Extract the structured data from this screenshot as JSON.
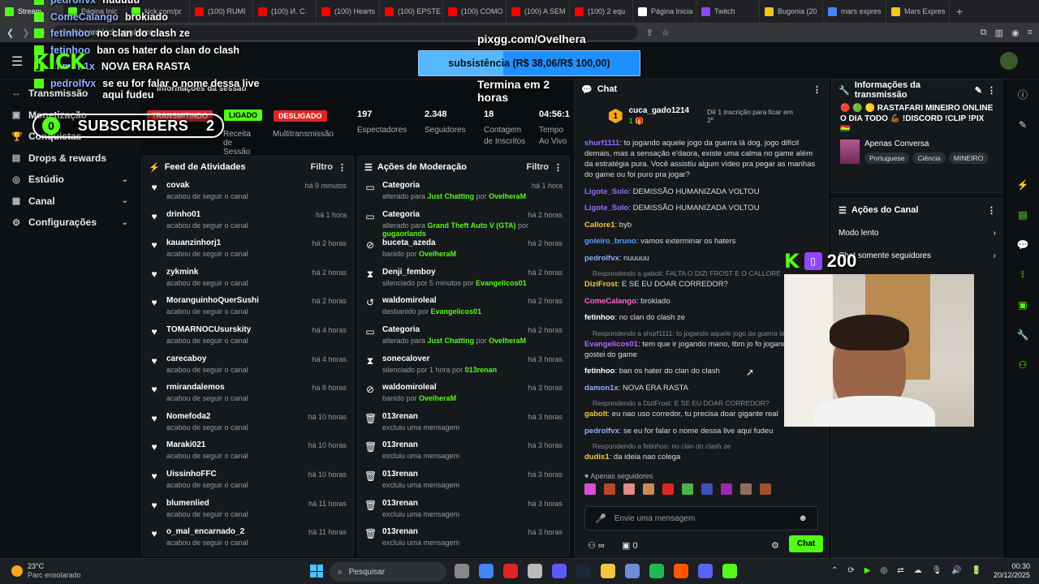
{
  "browser": {
    "tabs": [
      {
        "label": "Stream",
        "color": "#53fc18"
      },
      {
        "label": "Página Inic",
        "color": "#53fc18"
      },
      {
        "label": "kick.com/pr",
        "color": "#53fc18"
      },
      {
        "label": "(100) RUMI",
        "color": "#ff0000"
      },
      {
        "label": "(100) И. С.",
        "color": "#ff0000"
      },
      {
        "label": "(100) Hearts",
        "color": "#ff0000"
      },
      {
        "label": "(100) EPSTE",
        "color": "#ff0000"
      },
      {
        "label": "(100) COMO",
        "color": "#ff0000"
      },
      {
        "label": "(100) A SEM",
        "color": "#ff0000"
      },
      {
        "label": "(100) 2 equ",
        "color": "#ff0000"
      },
      {
        "label": "Página Inicia",
        "color": "#ffffff"
      },
      {
        "label": "Twitch",
        "color": "#9146ff"
      },
      {
        "label": "Bugonia (20",
        "color": "#f5c518"
      },
      {
        "label": "mars expres",
        "color": "#4285f4"
      },
      {
        "label": "Mars Expres",
        "color": "#f5c518"
      }
    ],
    "url": "dashboard.kick.com/stream"
  },
  "overlay": {
    "top_lines": [
      {
        "name": "pedrolfvx",
        "text": "nuuuuu"
      },
      {
        "name": "ComeCalango",
        "text": "brokiado"
      },
      {
        "name": "fetinhoo",
        "text": "no clan do clash ze"
      },
      {
        "name": "fetinhoo",
        "text": "ban os hater do clan do clash"
      },
      {
        "name": "damon1x",
        "text": "NOVA ERA RASTA"
      },
      {
        "name": "pedrolfvx",
        "text": "se eu for falar o nome dessa live aqui fudeu"
      }
    ],
    "logo": "KICK",
    "pix_url": "pixgg.com/Ovelhera",
    "goal": "subsistência (R$ 38,06/R$ 100,00)",
    "goal_progress": 0.3806,
    "ends": "Termina em 2 horas",
    "subs_left": "0",
    "subs_label": "SUBSCRIBERS",
    "subs_right": "2",
    "viewers": "200"
  },
  "sidebar": {
    "items": [
      {
        "icon": "↔",
        "label": "Transmissão"
      },
      {
        "icon": "▣",
        "label": "Monetização"
      },
      {
        "icon": "🏆",
        "label": "Conquistas"
      },
      {
        "icon": "▤",
        "label": "Drops & rewards"
      },
      {
        "icon": "◎",
        "label": "Estúdio"
      },
      {
        "icon": "▦",
        "label": "Canal"
      },
      {
        "icon": "⚙",
        "label": "Configurações"
      }
    ]
  },
  "stats": {
    "session_title": "Informações da sessão",
    "transmitindo": "TRANSMITINDO",
    "ligado": "LIGADO",
    "desligado": "DESLIGADO",
    "receita": "Receita de Sessão",
    "multi": "Multitransmissão",
    "espectadores": {
      "v": "197",
      "l": "Espectadores"
    },
    "seguidores": {
      "v": "2.348",
      "l": "Seguidores"
    },
    "inscritos": {
      "v": "18",
      "l": "Contagem de Inscritos"
    },
    "tempo": {
      "v": "04:56:1",
      "l": "Tempo Ao Vivo"
    }
  },
  "feed": {
    "title": "Feed de Atividades",
    "filter": "Filtro",
    "items": [
      {
        "n": "covak",
        "t": "há 9 minutos"
      },
      {
        "n": "drinho01",
        "t": "há 1 hora"
      },
      {
        "n": "kauanzinhorj1",
        "t": "há 2 horas"
      },
      {
        "n": "zykmink",
        "t": "há 2 horas"
      },
      {
        "n": "MoranguinhoQuerSushi",
        "t": "há 2 horas"
      },
      {
        "n": "TOMARNOCUsurskity",
        "t": "há 4 horas"
      },
      {
        "n": "carecaboy",
        "t": "há 4 horas"
      },
      {
        "n": "rmirandalemos",
        "t": "há 8 horas"
      },
      {
        "n": "Nomefoda2",
        "t": "há 10 horas"
      },
      {
        "n": "Maraki021",
        "t": "há 10 horas"
      },
      {
        "n": "UissinhoFFC",
        "t": "há 10 horas"
      },
      {
        "n": "blumenlied",
        "t": "há 11 horas"
      },
      {
        "n": "o_mal_encarnado_2",
        "t": "há 11 horas"
      }
    ],
    "sub": "acabou de seguir o canal"
  },
  "mod": {
    "title": "Ações de Moderação",
    "filter": "Filtro",
    "items": [
      {
        "i": "▭",
        "n": "Categoria",
        "a": "alterado para ",
        "g": "Just Chatting",
        "b": " por ",
        "g2": "OvelheraM",
        "t": "há 1 hora"
      },
      {
        "i": "▭",
        "n": "Categoria",
        "a": "alterado para ",
        "g": "Grand Theft Auto V (GTA)",
        "b": " por ",
        "g2": "gugaorlands",
        "t": "há 2 horas"
      },
      {
        "i": "⊘",
        "n": "buceta_azeda",
        "a": "banido por ",
        "g": "OvelheraM",
        "b": "",
        "g2": "",
        "t": "há 2 horas"
      },
      {
        "i": "⧗",
        "n": "Denji_femboy",
        "a": "silenciado por 5 minutos por ",
        "g": "Evangelicos01",
        "b": "",
        "g2": "",
        "t": "há 2 horas"
      },
      {
        "i": "↺",
        "n": "waldomiroleal",
        "a": "desbanido por ",
        "g": "Evangelicos01",
        "b": "",
        "g2": "",
        "t": "há 2 horas"
      },
      {
        "i": "▭",
        "n": "Categoria",
        "a": "alterado para ",
        "g": "Just Chatting",
        "b": " por ",
        "g2": "OvelheraM",
        "t": "há 2 horas"
      },
      {
        "i": "⧗",
        "n": "sonecalover",
        "a": "silenciado por 1 hora por ",
        "g": "013renan",
        "b": "",
        "g2": "",
        "t": "há 3 horas"
      },
      {
        "i": "⊘",
        "n": "waldomiroleal",
        "a": "banido por ",
        "g": "OvelheraM",
        "b": "",
        "g2": "",
        "t": "há 3 horas"
      },
      {
        "i": "🗑",
        "n": "013renan",
        "a": "excluiu uma mensagem",
        "g": "",
        "b": "",
        "g2": "",
        "t": "há 3 horas"
      },
      {
        "i": "🗑",
        "n": "013renan",
        "a": "excluiu uma mensagem",
        "g": "",
        "b": "",
        "g2": "",
        "t": "há 3 horas"
      },
      {
        "i": "🗑",
        "n": "013renan",
        "a": "excluiu uma mensagem",
        "g": "",
        "b": "",
        "g2": "",
        "t": "há 3 horas"
      },
      {
        "i": "🗑",
        "n": "013renan",
        "a": "excluiu uma mensagem",
        "g": "",
        "b": "",
        "g2": "",
        "t": "há 3 horas"
      },
      {
        "i": "🗑",
        "n": "013renan",
        "a": "excluiu uma mensagem",
        "g": "",
        "b": "",
        "g2": "",
        "t": "há 3 horas"
      }
    ]
  },
  "chat": {
    "title": "Chat",
    "gifter": "cuca_gado1214",
    "gift_count": "1",
    "gift_text": "Dê 1 inscrição para ficar em 2º",
    "messages": [
      {
        "r": "",
        "u": "shurf1111",
        "c": "#9b6bff",
        "t": "to jogando aquele jogo da guerra lá dog, jogo difícil demais, mas a sensação e'daora, existe uma calma no game além da estratégia pura. Você assistiu algum vídeo pra pegar as manhas do game ou foi puro pra jogar?"
      },
      {
        "r": "",
        "u": "Ligote_Solo",
        "c": "#9b6bff",
        "t": "DEMISSÃO HUMANIZADA VOLTOU"
      },
      {
        "r": "",
        "u": "Ligote_Solo",
        "c": "#9b6bff",
        "t": "DEMISSÃO HUMANIZADA VOLTOU"
      },
      {
        "r": "",
        "u": "Callore1",
        "c": "#f5c542",
        "t": "byb"
      },
      {
        "r": "",
        "u": "goleiro_bruno",
        "c": "#4fa3ff",
        "t": "vamos exterminar os haters"
      },
      {
        "r": "",
        "u": "pedrolfvx",
        "c": "#8fb0ff",
        "t": "nuuuuu"
      },
      {
        "r": "Respondendo a gabolt: FALTA O DIZI FROST E O CALLORE",
        "u": "DiziFrost",
        "c": "#f5c542",
        "t": "E SE EU DOAR CORREDOR?"
      },
      {
        "r": "",
        "u": "ComeCalango",
        "c": "#ff66cc",
        "t": "brokiado"
      },
      {
        "r": "",
        "u": "fetinhoo",
        "c": "#ffffff",
        "t": "no clan do clash ze"
      },
      {
        "r": "Respondendo a shurf1111: to jogando aquele jogo da guerra lá d",
        "u": "Evangelicos01",
        "c": "#b36bff",
        "t": "tem que ir jogando mano, tbm jo fo jogando e gostei do game"
      },
      {
        "r": "",
        "u": "fetinhoo",
        "c": "#ffffff",
        "t": "ban os hater do clan do clash"
      },
      {
        "r": "",
        "u": "damon1x",
        "c": "#8fb0ff",
        "t": "NOVA ERA RASTA"
      },
      {
        "r": "Respondendo a DiziFrost: E SE EU DOAR CORREDOR?",
        "u": "gabolt",
        "c": "#f5c542",
        "t": "eu nao uso corredor, tu precisa doar gigante real"
      },
      {
        "r": "",
        "u": "pedrolfvx",
        "c": "#8fb0ff",
        "t": "se eu for falar o nome dessa live aqui fudeu"
      },
      {
        "r": "Respondendo a fetinhoo: no clan do clash ze",
        "u": "dudis1",
        "c": "#f5c542",
        "t": "da ideia nao colega"
      }
    ],
    "followers_only": "Apenas seguidores",
    "placeholder": "Envie uma mensagem",
    "count": "0",
    "send": "Chat"
  },
  "info": {
    "title": "Informações da transmissão",
    "stream_title": "🔴 🟢 🟡 RASTAFARI MINEIRO ONLINE O DIA TODO 💪🏾 !DISCORD !CLIP !PIX 🇧🇴",
    "category": "Apenas Conversa",
    "tags": [
      "Portuguese",
      "Ciência",
      "MINEIRO"
    ]
  },
  "actions": {
    "title": "Ações do Canal",
    "items": [
      "Modo lento",
      "Chat somente seguidores"
    ]
  },
  "taskbar": {
    "temp": "23°C",
    "weather": "Parc ensolarado",
    "search": "Pesquisar",
    "time": "00:30",
    "date": "20/12/2025"
  },
  "colors": {
    "kick_green": "#53fc18",
    "live_red": "#e02424",
    "bg": "#0b0e10"
  }
}
